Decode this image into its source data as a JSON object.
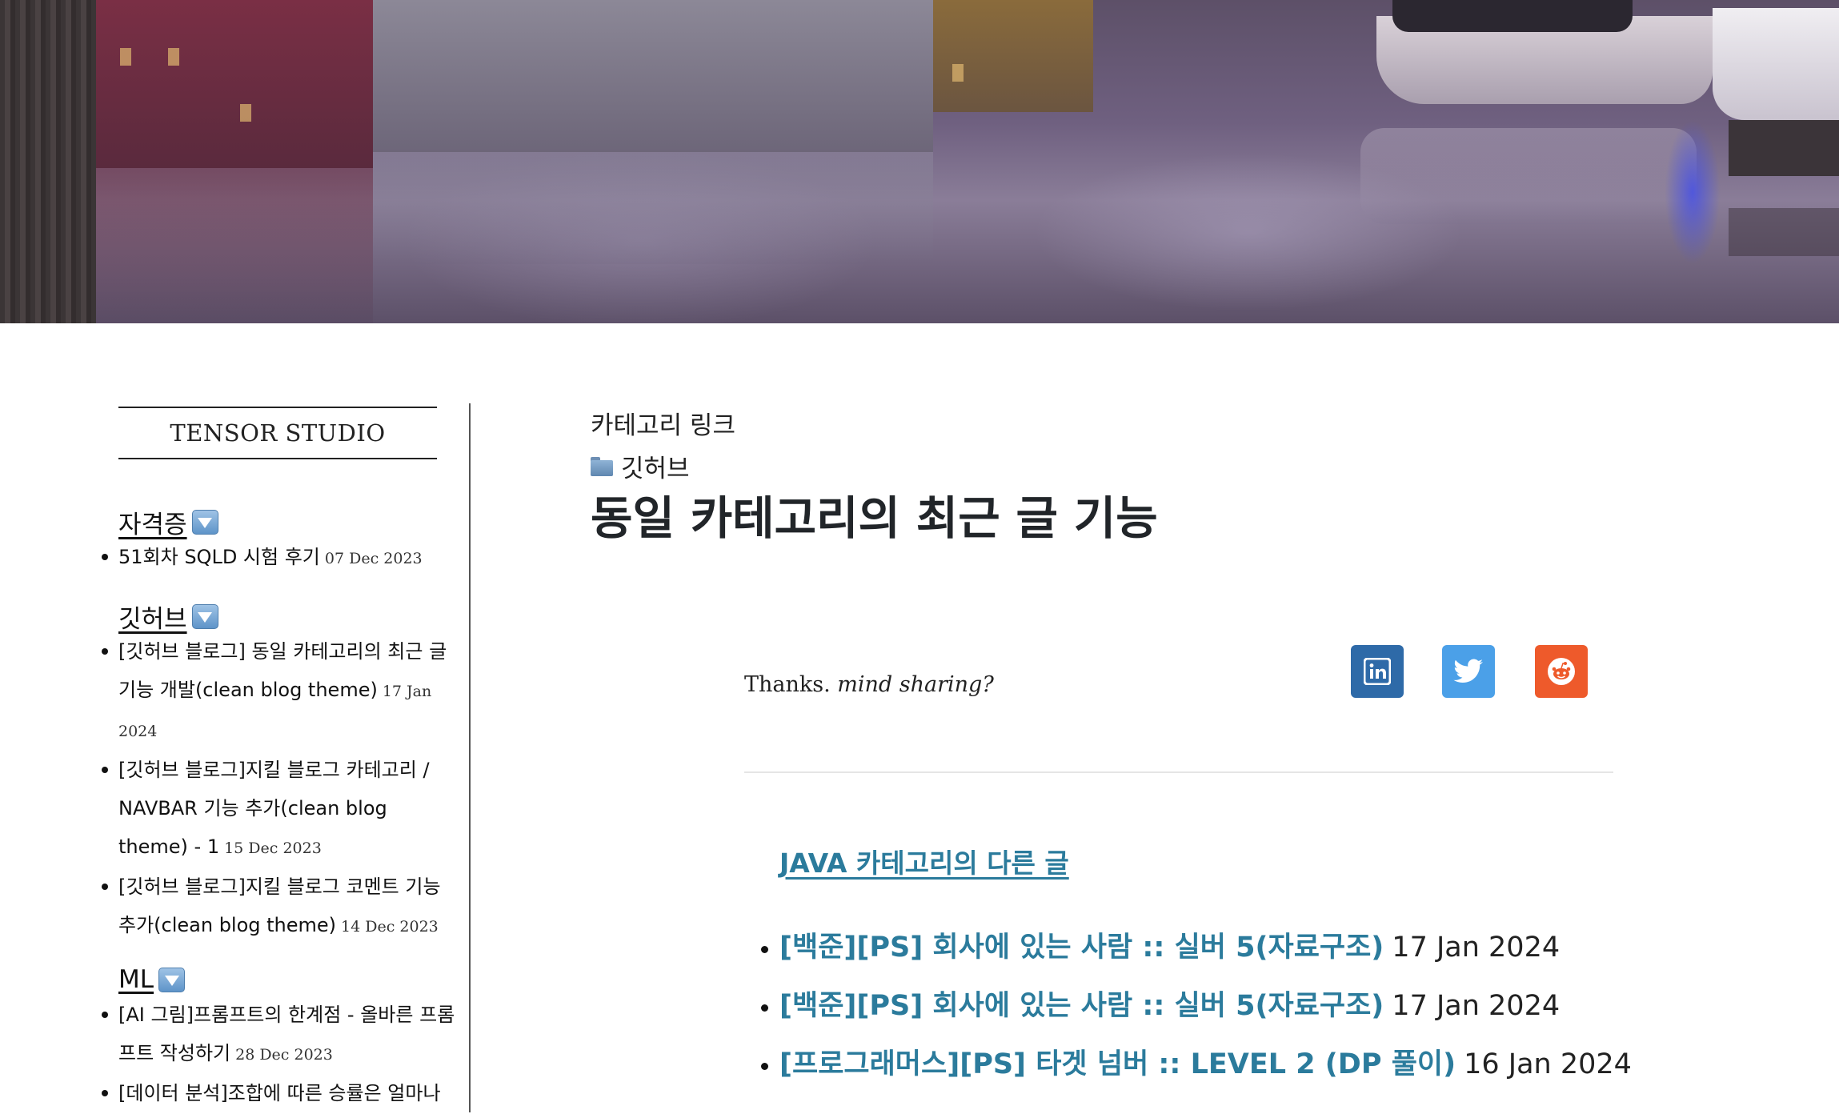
{
  "brand": "TENSOR STUDIO",
  "sidebar": {
    "categories": [
      {
        "title": "자격증",
        "posts": [
          {
            "title": "51회차 SQLD 시험 후기",
            "date": "07 Dec 2023"
          }
        ]
      },
      {
        "title": "깃허브",
        "posts": [
          {
            "title": "[깃허브 블로그] 동일 카테고리의 최근 글 기능 개발(clean blog theme)",
            "date": "17 Jan 2024"
          },
          {
            "title": "[깃허브 블로그]지킬 블로그 카테고리 / NAVBAR 기능 추가(clean blog theme) - 1",
            "date": "15 Dec 2023"
          },
          {
            "title": "[깃허브 블로그]지킬 블로그 코멘트 기능 추가(clean blog theme)",
            "date": "14 Dec 2023"
          }
        ]
      },
      {
        "title": "ML",
        "posts": [
          {
            "title": "[AI 그림]프롬프트의 한계점 - 올바른 프롬프트 작성하기",
            "date": "28 Dec 2023"
          },
          {
            "title": "[데이터 분석]조합에 따른 승률은 얼마나",
            "date": ""
          }
        ]
      }
    ]
  },
  "main": {
    "category_link_label": "카테고리 링크",
    "category_name": "깃허브",
    "title": "동일 카테고리의 최근 글 기능",
    "share": {
      "text_plain": "Thanks.",
      "text_italic": "mind sharing?",
      "buttons": [
        {
          "name": "linkedin",
          "icon": "linkedin-icon",
          "color": "#2e6aa8"
        },
        {
          "name": "twitter",
          "icon": "twitter-icon",
          "color": "#4ba0e8"
        },
        {
          "name": "reddit",
          "icon": "reddit-icon",
          "color": "#ee5a2b"
        }
      ]
    },
    "other_posts_heading": "JAVA 카테고리의 다른 글",
    "other_posts": [
      {
        "title": "[백준][PS] 회사에 있는 사람 :: 실버 5(자료구조)",
        "date": "17 Jan 2024"
      },
      {
        "title": "[백준][PS] 회사에 있는 사람 :: 실버 5(자료구조)",
        "date": "17 Jan 2024"
      },
      {
        "title": "[프로그래머스][PS] 타겟 넘버 :: LEVEL 2 (DP 풀이)",
        "date": "16 Jan 2024"
      }
    ]
  },
  "colors": {
    "link": "#2b7b9c",
    "text": "#212529"
  }
}
